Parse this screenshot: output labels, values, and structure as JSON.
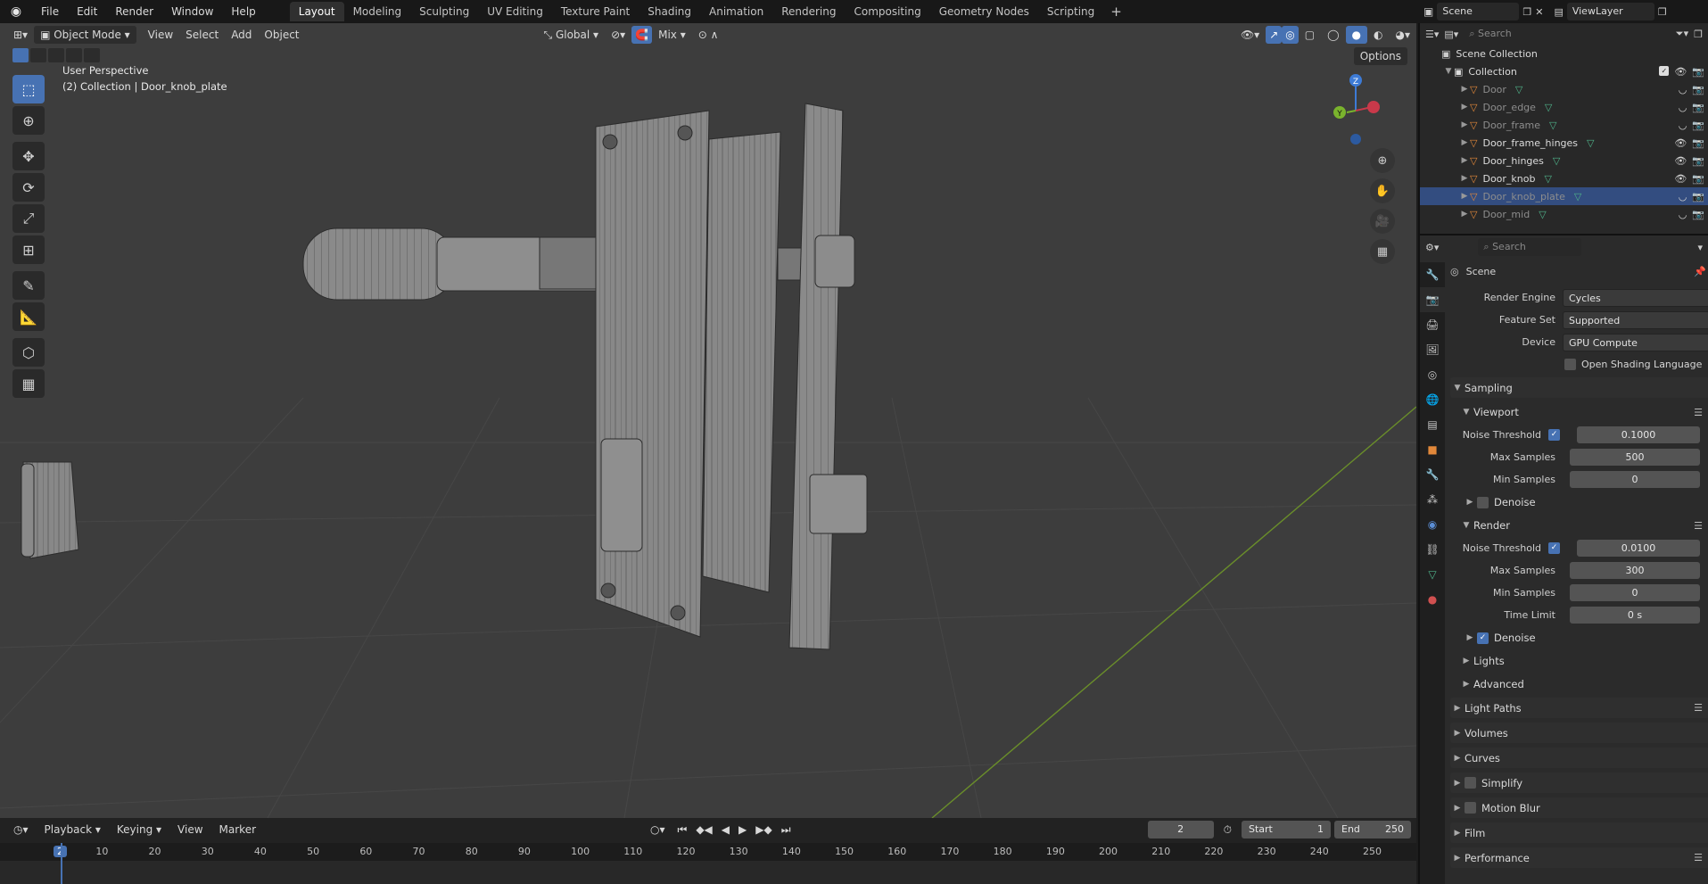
{
  "topbar": {
    "menus": [
      "File",
      "Edit",
      "Render",
      "Window",
      "Help"
    ],
    "workspaces": [
      "Layout",
      "Modeling",
      "Sculpting",
      "UV Editing",
      "Texture Paint",
      "Shading",
      "Animation",
      "Rendering",
      "Compositing",
      "Geometry Nodes",
      "Scripting"
    ],
    "active_workspace": "Layout",
    "add_symbol": "+",
    "scene": "Scene",
    "view_layer": "ViewLayer"
  },
  "viewport": {
    "mode": "Object Mode",
    "menus": [
      "View",
      "Select",
      "Add",
      "Object"
    ],
    "orientation": "Global",
    "snap": "Mix",
    "options": "Options",
    "perspective": "User Perspective",
    "context": "(2) Collection | Door_knob_plate",
    "gizmo_axes": {
      "x": "X",
      "y": "Y",
      "z": "Z"
    }
  },
  "outliner": {
    "search_placeholder": "Search",
    "root": "Scene Collection",
    "collection": "Collection",
    "objects": [
      {
        "name": "Door",
        "visible": false
      },
      {
        "name": "Door_edge",
        "visible": false
      },
      {
        "name": "Door_frame",
        "visible": false
      },
      {
        "name": "Door_frame_hinges",
        "visible": true
      },
      {
        "name": "Door_hinges",
        "visible": true
      },
      {
        "name": "Door_knob",
        "visible": true
      },
      {
        "name": "Door_knob_plate",
        "visible": false,
        "selected": true
      },
      {
        "name": "Door_mid",
        "visible": false
      }
    ]
  },
  "properties": {
    "search_placeholder": "Search",
    "context": "Scene",
    "render_engine_label": "Render Engine",
    "render_engine": "Cycles",
    "feature_set_label": "Feature Set",
    "feature_set": "Supported",
    "device_label": "Device",
    "device": "GPU Compute",
    "osl": "Open Shading Language",
    "sampling": "Sampling",
    "viewport_sub": "Viewport",
    "noise_threshold_label": "Noise Threshold",
    "vp_noise": "0.1000",
    "max_samples_label": "Max Samples",
    "vp_max": "500",
    "min_samples_label": "Min Samples",
    "vp_min": "0",
    "denoise": "Denoise",
    "render_sub": "Render",
    "r_noise": "0.0100",
    "r_max": "300",
    "r_min": "0",
    "time_limit_label": "Time Limit",
    "r_time": "0 s",
    "lights": "Lights",
    "advanced": "Advanced",
    "panels": [
      "Light Paths",
      "Volumes",
      "Curves",
      "Simplify",
      "Motion Blur",
      "Film",
      "Performance"
    ]
  },
  "timeline": {
    "menus": [
      "Playback",
      "Keying",
      "View",
      "Marker"
    ],
    "current_frame": "2",
    "start_label": "Start",
    "start": "1",
    "end_label": "End",
    "end": "250",
    "ticks": [
      "2",
      "10",
      "20",
      "30",
      "40",
      "50",
      "60",
      "70",
      "80",
      "90",
      "100",
      "110",
      "120",
      "130",
      "140",
      "150",
      "160",
      "170",
      "180",
      "190",
      "200",
      "210",
      "220",
      "230",
      "240",
      "250"
    ]
  }
}
